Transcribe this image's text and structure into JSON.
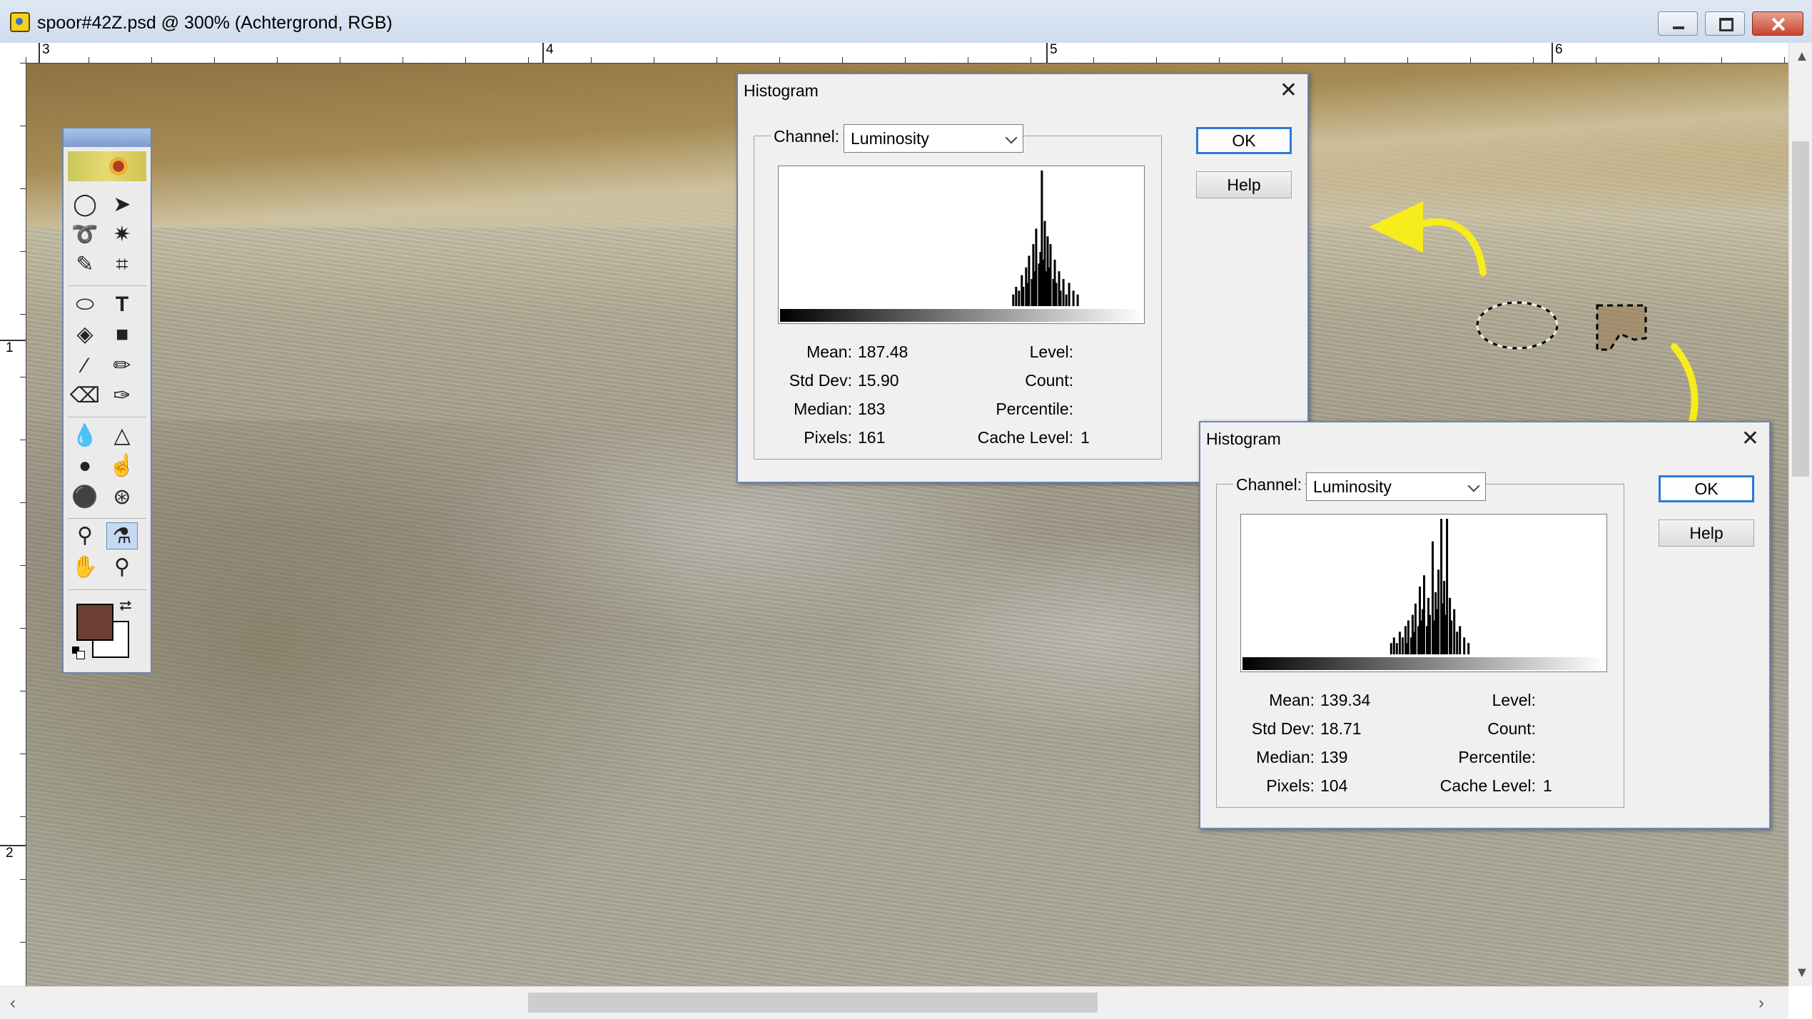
{
  "window": {
    "title": "spoor#42Z.psd @ 300% (Achtergrond, RGB)"
  },
  "rulers": {
    "top_labels": [
      "3",
      "4",
      "5",
      "6"
    ],
    "left_labels": [
      "1",
      "2"
    ]
  },
  "colors": {
    "foreground": "#6b3f34",
    "background": "#ffffff",
    "arrow": "#f7ec1c",
    "dialog_accent": "#2b79d8"
  },
  "toolbox": {
    "tools": [
      "elliptical-marquee-icon",
      "move-icon",
      "lasso-icon",
      "magic-wand-icon",
      "airbrush-icon",
      "crop-icon",
      "path-selection-icon",
      "type-icon",
      "paint-bucket-icon",
      "gradient-icon",
      "brush-icon",
      "pencil-icon",
      "eraser-icon",
      "history-brush-icon",
      "blur-icon",
      "sharpen-icon",
      "dodge-icon",
      "smudge-icon",
      "burn-icon",
      "sponge-icon",
      "clone-stamp-icon",
      "eyedropper-icon",
      "hand-icon",
      "zoom-icon"
    ],
    "active_tool": "eyedropper-icon"
  },
  "histogram_1": {
    "title": "Histogram",
    "channel_label": "Channel:",
    "channel_value": "Luminosity",
    "ok_label": "OK",
    "help_label": "Help",
    "labels": {
      "mean": "Mean:",
      "std_dev": "Std Dev:",
      "median": "Median:",
      "pixels": "Pixels:",
      "level": "Level:",
      "count": "Count:",
      "percentile": "Percentile:",
      "cache_level": "Cache Level:"
    },
    "mean": "187.48",
    "std_dev": "15.90",
    "median": "183",
    "pixels": "161",
    "cache_level": "1",
    "bins": [
      [
        163,
        3
      ],
      [
        165,
        5
      ],
      [
        167,
        4
      ],
      [
        169,
        8
      ],
      [
        170,
        5
      ],
      [
        172,
        10
      ],
      [
        173,
        6
      ],
      [
        174,
        13
      ],
      [
        176,
        7
      ],
      [
        177,
        16
      ],
      [
        178,
        9
      ],
      [
        179,
        20
      ],
      [
        181,
        11
      ],
      [
        182,
        14
      ],
      [
        183,
        35
      ],
      [
        184,
        12
      ],
      [
        185,
        22
      ],
      [
        186,
        9
      ],
      [
        187,
        18
      ],
      [
        188,
        10
      ],
      [
        189,
        16
      ],
      [
        191,
        7
      ],
      [
        192,
        12
      ],
      [
        193,
        6
      ],
      [
        195,
        9
      ],
      [
        196,
        4
      ],
      [
        198,
        7
      ],
      [
        200,
        3
      ],
      [
        202,
        6
      ],
      [
        205,
        4
      ],
      [
        208,
        3
      ]
    ]
  },
  "histogram_2": {
    "title": "Histogram",
    "channel_label": "Channel:",
    "channel_value": "Luminosity",
    "ok_label": "OK",
    "help_label": "Help",
    "labels": {
      "mean": "Mean:",
      "std_dev": "Std Dev:",
      "median": "Median:",
      "pixels": "Pixels:",
      "level": "Level:",
      "count": "Count:",
      "percentile": "Percentile:",
      "cache_level": "Cache Level:"
    },
    "mean": "139.34",
    "std_dev": "18.71",
    "median": "139",
    "pixels": "104",
    "cache_level": "1",
    "bins": [
      [
        104,
        2
      ],
      [
        106,
        3
      ],
      [
        108,
        2
      ],
      [
        110,
        4
      ],
      [
        112,
        3
      ],
      [
        114,
        5
      ],
      [
        115,
        2
      ],
      [
        116,
        6
      ],
      [
        118,
        3
      ],
      [
        119,
        7
      ],
      [
        120,
        4
      ],
      [
        121,
        9
      ],
      [
        123,
        5
      ],
      [
        124,
        12
      ],
      [
        125,
        6
      ],
      [
        126,
        8
      ],
      [
        127,
        14
      ],
      [
        129,
        5
      ],
      [
        130,
        10
      ],
      [
        131,
        7
      ],
      [
        133,
        20
      ],
      [
        134,
        6
      ],
      [
        135,
        11
      ],
      [
        136,
        8
      ],
      [
        137,
        15
      ],
      [
        139,
        24
      ],
      [
        140,
        9
      ],
      [
        141,
        13
      ],
      [
        142,
        7
      ],
      [
        143,
        24
      ],
      [
        145,
        10
      ],
      [
        146,
        6
      ],
      [
        148,
        8
      ],
      [
        150,
        4
      ],
      [
        152,
        5
      ],
      [
        155,
        3
      ],
      [
        158,
        2
      ]
    ]
  }
}
